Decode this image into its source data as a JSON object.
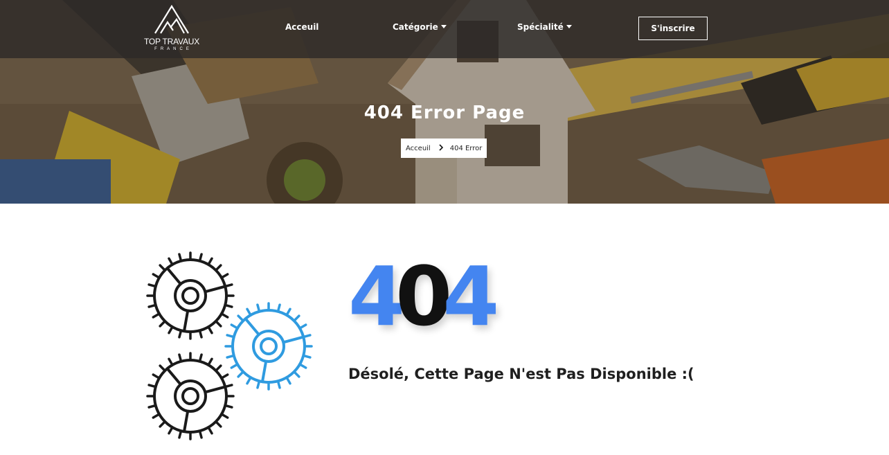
{
  "nav": {
    "logo_title": "TOP TRAVAUX",
    "logo_subtitle": "FRANCE",
    "items": [
      {
        "label": "Acceuil",
        "dropdown": false
      },
      {
        "label": "Catégorie",
        "dropdown": true
      },
      {
        "label": "Spécialité",
        "dropdown": true
      }
    ],
    "signup_label": "S'inscrire"
  },
  "hero": {
    "title": "404 Error Page",
    "breadcrumb": {
      "home": "Acceuil",
      "current": "404 Error"
    }
  },
  "error": {
    "code_digits": [
      "4",
      "0",
      "4"
    ],
    "message": "Désolé, Cette Page N'est Pas Disponible :("
  },
  "colors": {
    "accent_blue": "#4485f0",
    "gear_blue": "#2f9be0",
    "gear_dark": "#1a1a1a"
  },
  "icons": [
    "logo-mountain-icon",
    "caret-down-icon",
    "chevron-right-icon",
    "gear-icon"
  ]
}
